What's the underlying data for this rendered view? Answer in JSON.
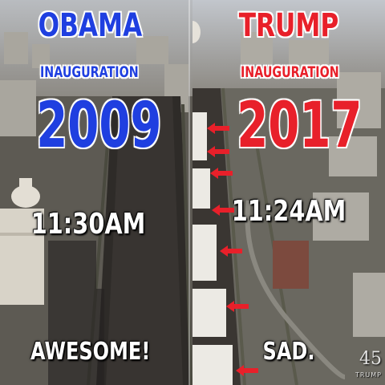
{
  "left": {
    "name": "OBAMA",
    "subtitle": "INAUGURATION",
    "year": "2009",
    "time": "11:30AM",
    "verdict": "AWESOME!",
    "name_color": "#1f3fe0"
  },
  "right": {
    "name": "TRUMP",
    "subtitle": "INAUGURATION",
    "year": "2017",
    "time": "11:24AM",
    "verdict": "SAD.",
    "name_color": "#e8202a"
  },
  "logo": {
    "number": "45",
    "text": "TRUMP"
  },
  "annotations": {
    "arrow_color": "#e8202a",
    "arrow_count": 8
  }
}
